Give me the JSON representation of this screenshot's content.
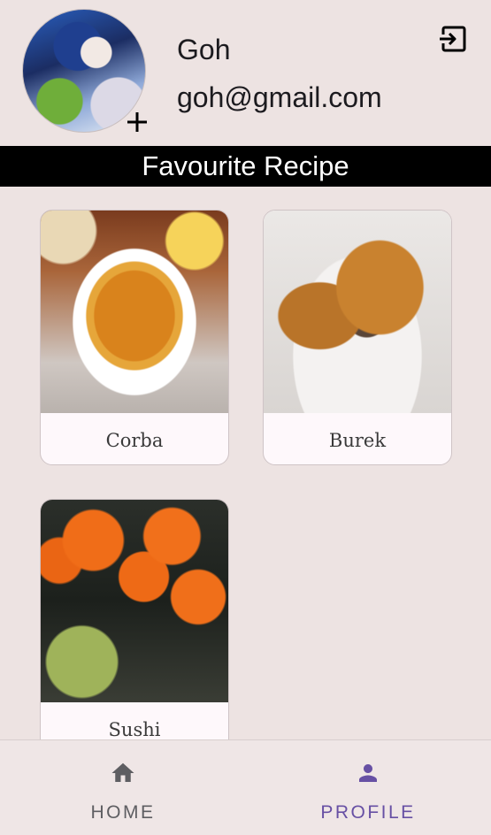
{
  "profile": {
    "name": "Goh",
    "email": "goh@gmail.com",
    "avatar_icon": "avatar-image",
    "add_photo_icon": "plus-icon",
    "logout_icon": "logout-icon"
  },
  "section": {
    "title": "Favourite Recipe"
  },
  "recipes": [
    {
      "name": "Corba",
      "image": "soup-image"
    },
    {
      "name": "Burek",
      "image": "pastry-image"
    },
    {
      "name": "Sushi",
      "image": "sushi-image"
    }
  ],
  "bottom_nav": {
    "items": [
      {
        "label": "HOME",
        "icon": "home-icon",
        "active": false
      },
      {
        "label": "PROFILE",
        "icon": "person-icon",
        "active": true
      }
    ]
  },
  "colors": {
    "background": "#ede3e2",
    "section_bar": "#000000",
    "active_nav": "#6750a4",
    "inactive_nav": "#5e5e62"
  }
}
